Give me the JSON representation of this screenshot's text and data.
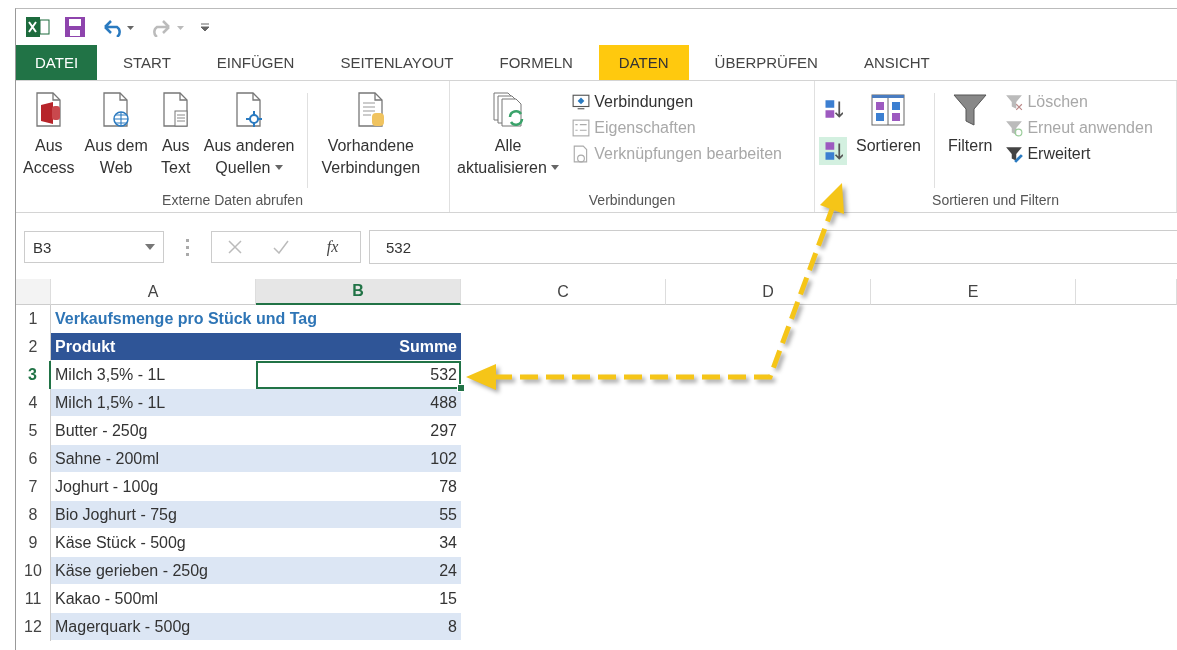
{
  "tabs": [
    {
      "label": "DATEI",
      "kind": "file",
      "selected": false
    },
    {
      "label": "START",
      "kind": "tab",
      "selected": false
    },
    {
      "label": "EINFÜGEN",
      "kind": "tab",
      "selected": false
    },
    {
      "label": "SEITENLAYOUT",
      "kind": "tab",
      "selected": false
    },
    {
      "label": "FORMELN",
      "kind": "tab",
      "selected": false
    },
    {
      "label": "DATEN",
      "kind": "tab",
      "selected": true
    },
    {
      "label": "ÜBERPRÜFEN",
      "kind": "tab",
      "selected": false
    },
    {
      "label": "ANSICHT",
      "kind": "tab",
      "selected": false
    }
  ],
  "ribbon_groups": [
    {
      "label": "Externe Daten abrufen",
      "items": [
        {
          "kind": "large",
          "lines": [
            "Aus",
            "Access"
          ],
          "dropdown": false
        },
        {
          "kind": "large",
          "lines": [
            "Aus dem",
            "Web"
          ],
          "dropdown": false
        },
        {
          "kind": "large",
          "lines": [
            "Aus",
            "Text"
          ],
          "dropdown": false
        },
        {
          "kind": "large",
          "lines": [
            "Aus anderen",
            "Quellen"
          ],
          "dropdown": true
        },
        {
          "kind": "separator"
        },
        {
          "kind": "large",
          "lines": [
            "Vorhandene",
            "Verbindungen"
          ],
          "dropdown": false
        }
      ]
    },
    {
      "label": "Verbindungen",
      "items": [
        {
          "kind": "large",
          "lines": [
            "Alle",
            "aktualisieren"
          ],
          "dropdown": true
        },
        {
          "kind": "stack",
          "entries": [
            {
              "label": "Verbindungen",
              "disabled": false
            },
            {
              "label": "Eigenschaften",
              "disabled": true
            },
            {
              "label": "Verknüpfungen bearbeiten",
              "disabled": true
            }
          ]
        }
      ]
    },
    {
      "label": "Sortieren und Filtern",
      "items": [
        {
          "kind": "sort_buttons",
          "buttons": [
            {
              "highlighted": false
            },
            {
              "highlighted": true
            }
          ]
        },
        {
          "kind": "large",
          "lines": [
            "Sortieren"
          ],
          "dropdown": false
        },
        {
          "kind": "separator"
        },
        {
          "kind": "large",
          "lines": [
            "Filtern"
          ],
          "dropdown": false
        },
        {
          "kind": "stack",
          "entries": [
            {
              "label": "Löschen",
              "disabled": true
            },
            {
              "label": "Erneut anwenden",
              "disabled": true
            },
            {
              "label": "Erweitert",
              "disabled": false
            }
          ]
        }
      ]
    }
  ],
  "formula_bar": {
    "name_box": "B3",
    "function_label": "fx",
    "formula": "532"
  },
  "sheet": {
    "columns": [
      {
        "label": "A",
        "selected": false
      },
      {
        "label": "B",
        "selected": true
      },
      {
        "label": "C",
        "selected": false
      },
      {
        "label": "D",
        "selected": false
      },
      {
        "label": "E",
        "selected": false
      }
    ],
    "title_row": {
      "number": "1",
      "text": "Verkaufsmenge pro Stück und Tag"
    },
    "header_row": {
      "number": "2",
      "product": "Produkt",
      "sum": "Summe"
    },
    "rows": [
      {
        "number": "3",
        "product": "Milch 3,5% - 1L",
        "sum": "532",
        "selected": true
      },
      {
        "number": "4",
        "product": "Milch 1,5% - 1L",
        "sum": "488",
        "selected": false
      },
      {
        "number": "5",
        "product": "Butter - 250g",
        "sum": "297",
        "selected": false
      },
      {
        "number": "6",
        "product": "Sahne - 200ml",
        "sum": "102",
        "selected": false
      },
      {
        "number": "7",
        "product": "Joghurt - 100g",
        "sum": "78",
        "selected": false
      },
      {
        "number": "8",
        "product": "Bio Joghurt - 75g",
        "sum": "55",
        "selected": false
      },
      {
        "number": "9",
        "product": "Käse Stück - 500g",
        "sum": "34",
        "selected": false
      },
      {
        "number": "10",
        "product": "Käse gerieben - 250g",
        "sum": "24",
        "selected": false
      },
      {
        "number": "11",
        "product": "Kakao - 500ml",
        "sum": "15",
        "selected": false
      },
      {
        "number": "12",
        "product": "Magerquark - 500g",
        "sum": "8",
        "selected": false
      }
    ]
  }
}
